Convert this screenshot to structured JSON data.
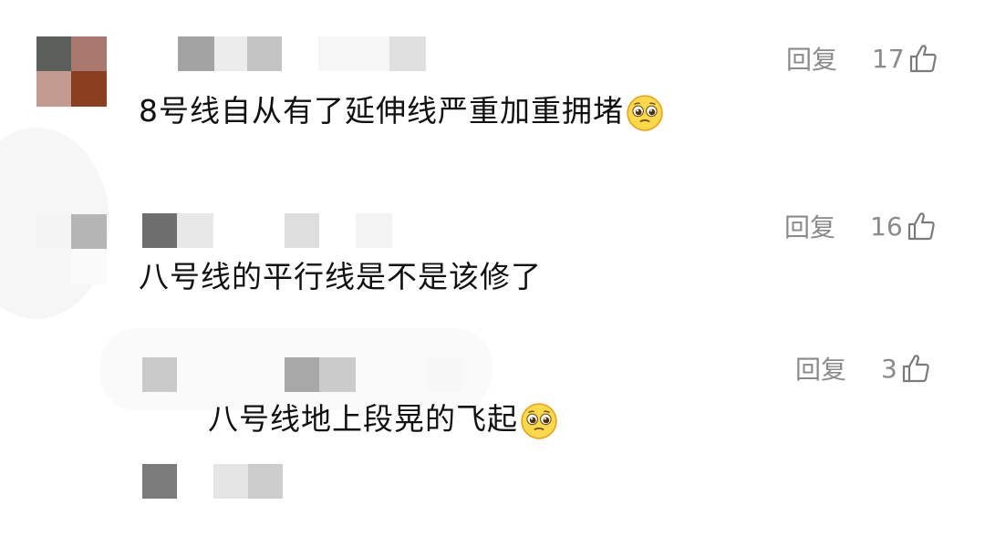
{
  "comments": [
    {
      "text": "8号线自从有了延伸线严重加重拥堵",
      "emoji": "pleading-face",
      "reply_label": "回复",
      "likes": "17"
    },
    {
      "text": "八号线的平行线是不是该修了",
      "emoji": "",
      "reply_label": "回复",
      "likes": "16"
    },
    {
      "text": "八号线地上段晃的飞起",
      "emoji": "pleading-face",
      "reply_label": "回复",
      "likes": "3"
    }
  ],
  "colors": {
    "text": "#111111",
    "action_gray": "#8a8a8a",
    "background": "#ffffff"
  }
}
